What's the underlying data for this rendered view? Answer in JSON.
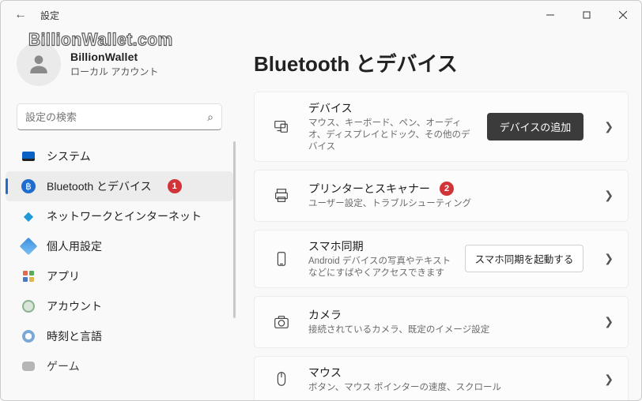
{
  "window": {
    "title": "設定"
  },
  "user": {
    "name": "BillionWallet",
    "account_type": "ローカル アカウント",
    "watermark": "BillionWallet.com"
  },
  "search": {
    "placeholder": "設定の検索"
  },
  "sidebar": {
    "items": [
      {
        "label": "システム"
      },
      {
        "label": "Bluetooth とデバイス"
      },
      {
        "label": "ネットワークとインターネット"
      },
      {
        "label": "個人用設定"
      },
      {
        "label": "アプリ"
      },
      {
        "label": "アカウント"
      },
      {
        "label": "時刻と言語"
      },
      {
        "label": "ゲーム"
      }
    ],
    "active_index": 1,
    "badge_on_index": 1,
    "badge_text": "1"
  },
  "page": {
    "title": "Bluetooth とデバイス"
  },
  "cards": {
    "devices": {
      "title": "デバイス",
      "subtitle": "マウス、キーボード、ペン、オーディオ、ディスプレイとドック、その他のデバイス",
      "action": "デバイスの追加"
    },
    "printers": {
      "title": "プリンターとスキャナー",
      "subtitle": "ユーザー設定、トラブルシューティング",
      "badge": "2"
    },
    "phone": {
      "title": "スマホ同期",
      "subtitle": "Android デバイスの写真やテキストなどにすばやくアクセスできます",
      "action": "スマホ同期を起動する"
    },
    "camera": {
      "title": "カメラ",
      "subtitle": "接続されているカメラ、既定のイメージ設定"
    },
    "mouse": {
      "title": "マウス",
      "subtitle": "ボタン、マウス ポインターの速度、スクロール"
    }
  }
}
